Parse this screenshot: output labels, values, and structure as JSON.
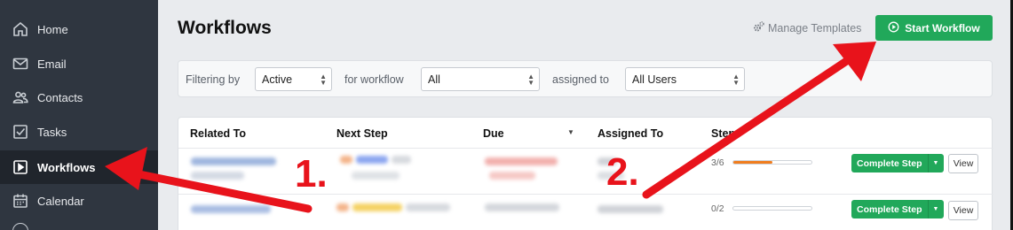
{
  "sidebar": {
    "items": [
      {
        "label": "Home",
        "icon": "home-icon"
      },
      {
        "label": "Email",
        "icon": "envelope-icon"
      },
      {
        "label": "Contacts",
        "icon": "contacts-icon"
      },
      {
        "label": "Tasks",
        "icon": "checkbox-icon"
      },
      {
        "label": "Workflows",
        "icon": "play-square-icon",
        "active": true
      },
      {
        "label": "Calendar",
        "icon": "calendar-icon"
      }
    ]
  },
  "header": {
    "title": "Workflows",
    "manage_templates": "Manage Templates",
    "start_workflow": "Start Workflow"
  },
  "filters": {
    "filtering_by_label": "Filtering by",
    "status_value": "Active",
    "for_workflow_label": "for workflow",
    "workflow_value": "All",
    "assigned_to_label": "assigned to",
    "assigned_value": "All Users"
  },
  "table": {
    "columns": [
      "Related To",
      "Next Step",
      "Due",
      "Assigned To",
      "Steps"
    ],
    "rows": [
      {
        "steps": "3/6",
        "progress": 0.5,
        "complete_label": "Complete Step",
        "view_label": "View"
      },
      {
        "steps": "0/2",
        "progress": 0,
        "complete_label": "Complete Step",
        "view_label": "View"
      }
    ]
  },
  "annotations": {
    "marker_1": "1.",
    "marker_2": "2."
  },
  "colors": {
    "sidebar_bg": "#2f3640",
    "accent_green": "#21a85a",
    "arrow_red": "#e8131b",
    "progress_orange": "#f07d1e"
  }
}
